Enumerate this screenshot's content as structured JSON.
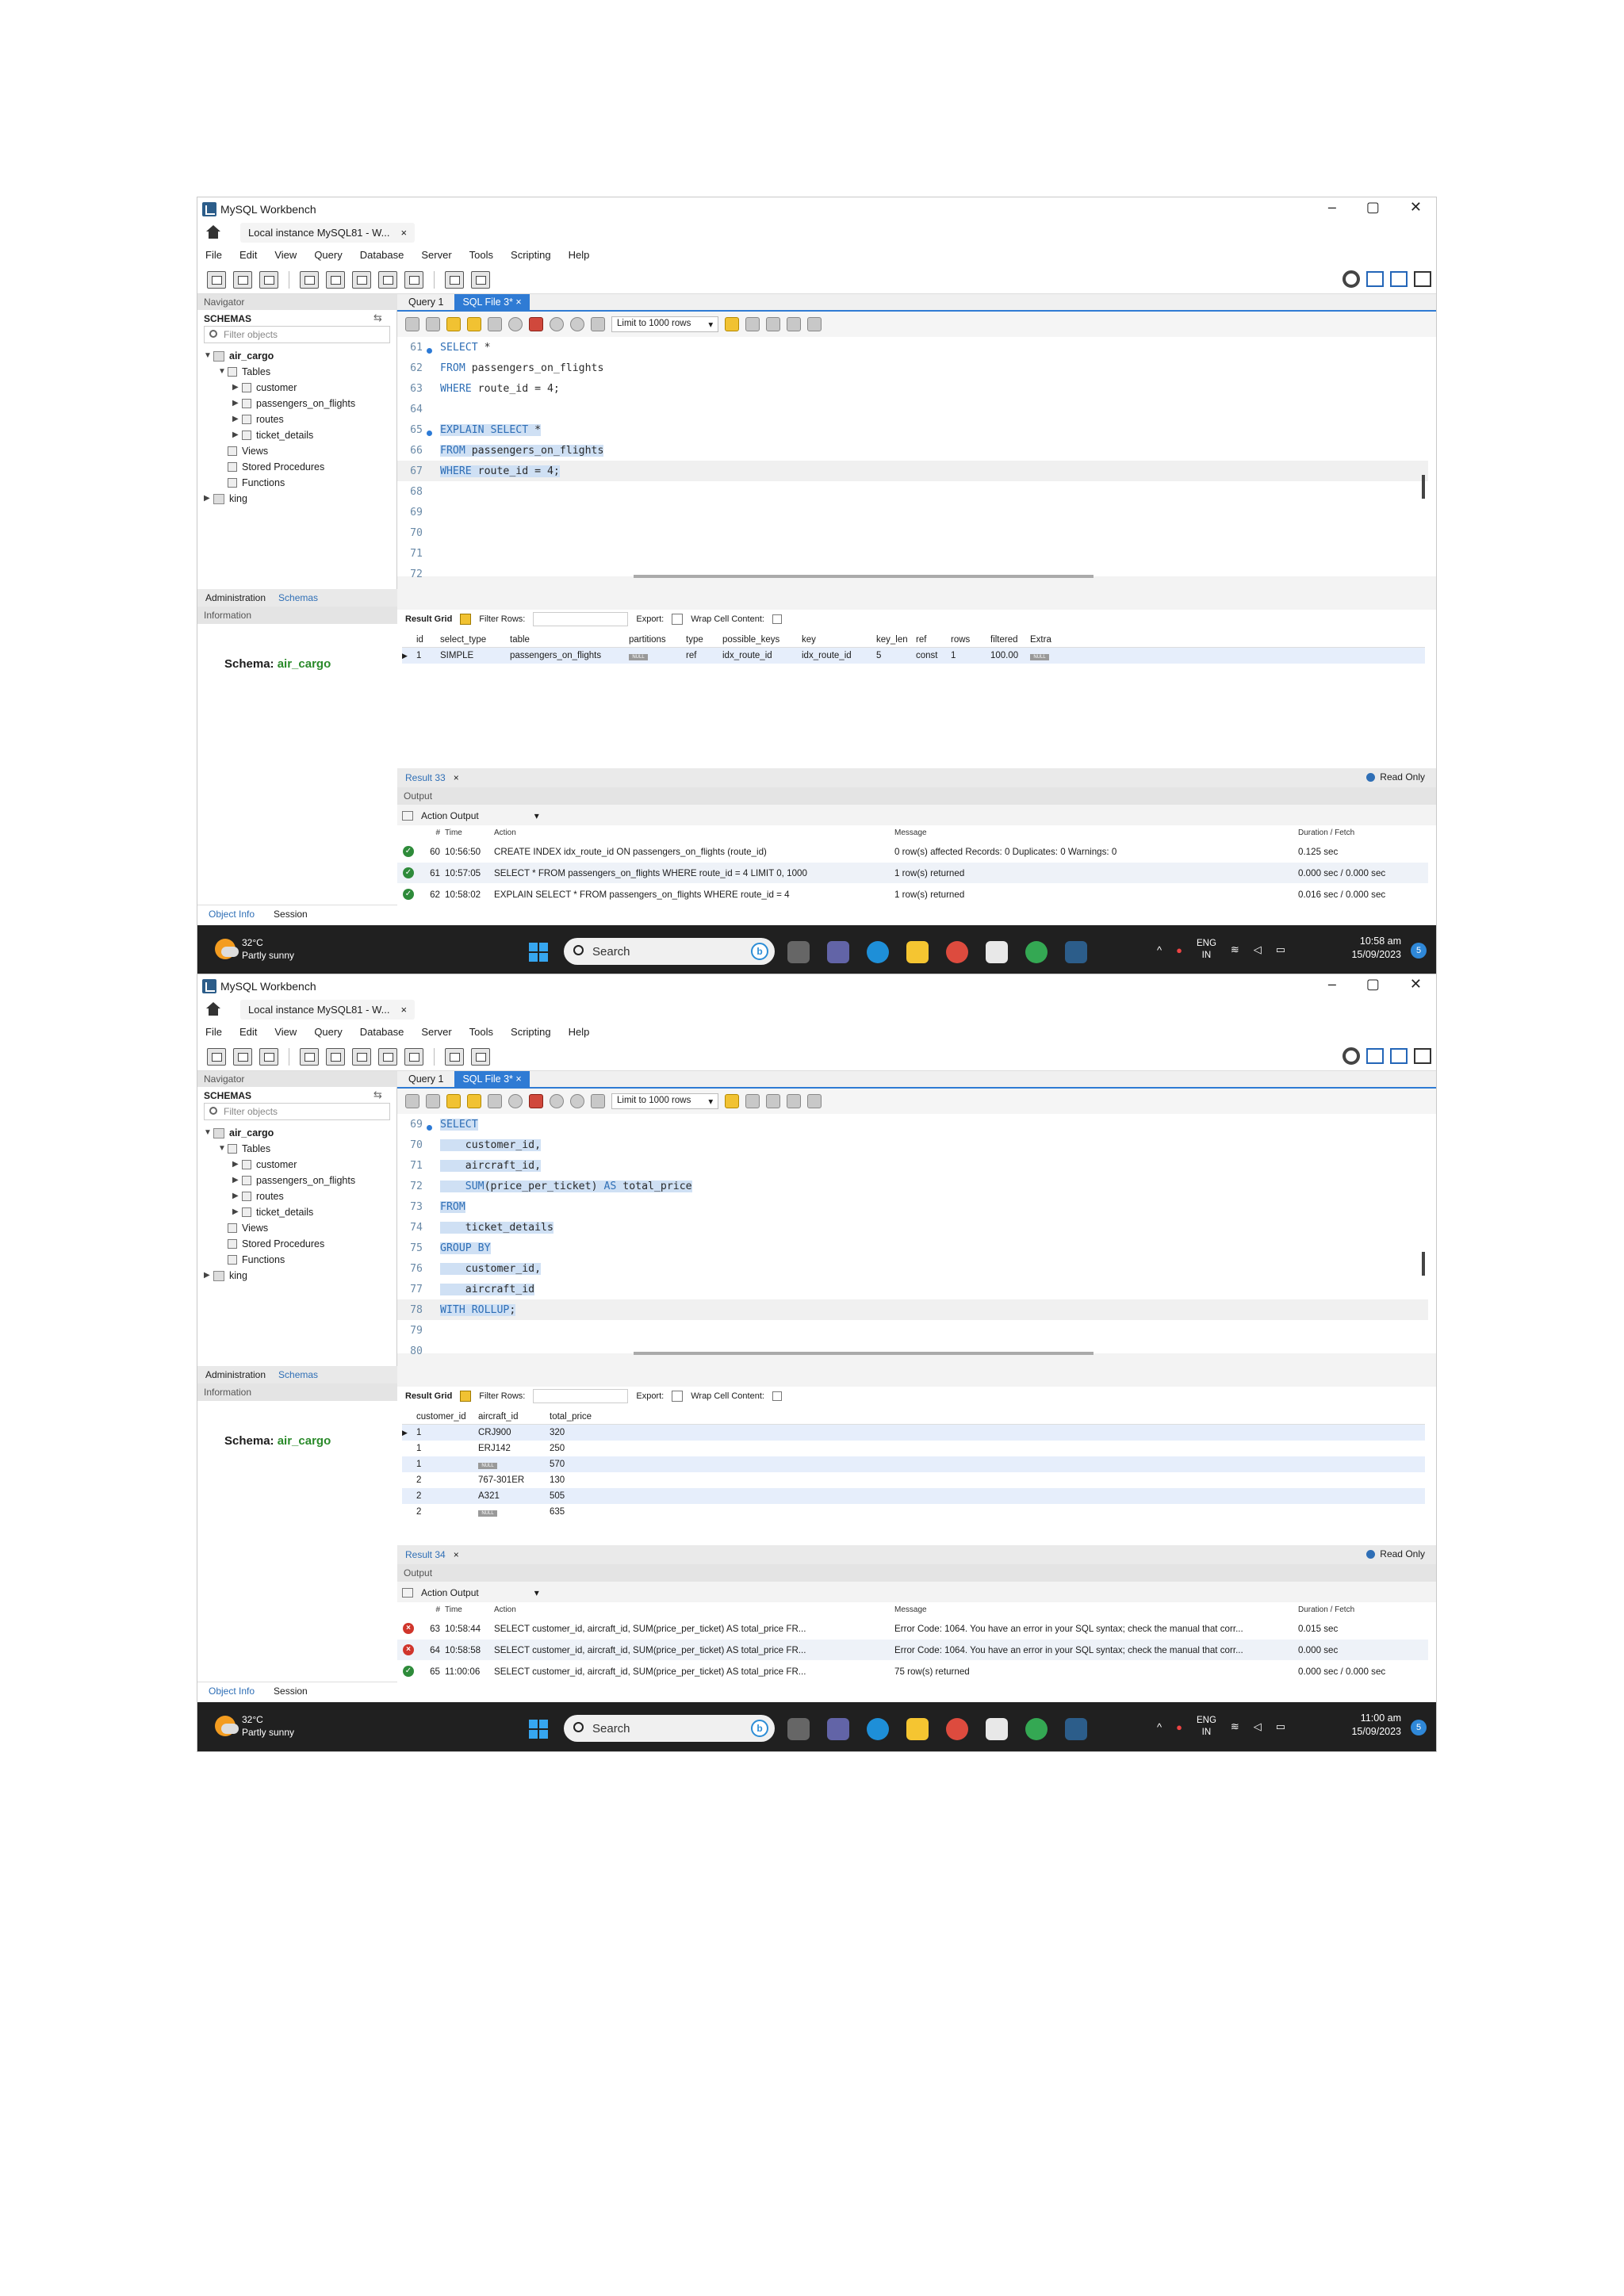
{
  "window": {
    "title": "MySQL Workbench",
    "tab": "Local instance MySQL81 - W...",
    "close_tab": "×",
    "ctl_min": "–",
    "ctl_max": "▢",
    "ctl_close": "✕"
  },
  "menu": [
    "File",
    "Edit",
    "View",
    "Query",
    "Database",
    "Server",
    "Tools",
    "Scripting",
    "Help"
  ],
  "navigator": {
    "header": "Navigator",
    "schemas_title": "SCHEMAS",
    "filter_placeholder": "Filter objects",
    "tree": {
      "db": "air_cargo",
      "tables_label": "Tables",
      "tables": [
        "customer",
        "passengers_on_flights",
        "routes",
        "ticket_details"
      ],
      "views": "Views",
      "procs": "Stored Procedures",
      "funcs": "Functions",
      "other_db": "king"
    },
    "tab_admin": "Administration",
    "tab_schemas": "Schemas",
    "info_header": "Information",
    "schema_label": "Schema:",
    "schema_name": "air_cargo",
    "obj_info": "Object Info",
    "session": "Session"
  },
  "editor_tabs": {
    "query1": "Query 1",
    "sqlfile": "SQL File 3*",
    "close": "×"
  },
  "sql_toolbar": {
    "limit": "Limit to 1000 rows",
    "arrow": "▾"
  },
  "result_toolbar": {
    "grid": "Result Grid",
    "filter": "Filter Rows:",
    "export": "Export:",
    "wrap": "Wrap Cell Content:"
  },
  "output": {
    "header": "Output",
    "selector": "Action Output",
    "col_time": "Time",
    "col_action": "Action",
    "col_message": "Message",
    "col_duration": "Duration / Fetch",
    "col_num": "#"
  },
  "read_only": "Read Only",
  "taskbar": {
    "temp": "32°C",
    "weather": "Partly sunny",
    "search": "Search",
    "lang1": "ENG",
    "lang2": "IN",
    "date": "15/09/2023",
    "notif": "5"
  },
  "shot1": {
    "lines": [
      {
        "n": "61",
        "dot": true,
        "text": "SELECT *",
        "hl": false
      },
      {
        "n": "62",
        "dot": false,
        "text": "FROM passengers_on_flights",
        "hl": false
      },
      {
        "n": "63",
        "dot": false,
        "text": "WHERE route_id = 4;",
        "hl": false
      },
      {
        "n": "64",
        "dot": false,
        "text": "",
        "hl": false
      },
      {
        "n": "65",
        "dot": true,
        "text": "EXPLAIN SELECT *",
        "hl": true
      },
      {
        "n": "66",
        "dot": false,
        "text": "FROM passengers_on_flights",
        "hl": true
      },
      {
        "n": "67",
        "dot": false,
        "text": "WHERE route_id = 4;",
        "hl": true
      },
      {
        "n": "68",
        "dot": false,
        "text": "",
        "hl": false
      },
      {
        "n": "69",
        "dot": false,
        "text": "",
        "hl": false
      },
      {
        "n": "70",
        "dot": false,
        "text": "",
        "hl": false
      },
      {
        "n": "71",
        "dot": false,
        "text": "",
        "hl": false
      },
      {
        "n": "72",
        "dot": false,
        "text": "",
        "hl": false
      }
    ],
    "grid_headers": [
      "id",
      "select_type",
      "table",
      "partitions",
      "type",
      "possible_keys",
      "key",
      "key_len",
      "ref",
      "rows",
      "filtered",
      "Extra"
    ],
    "grid_rows": [
      [
        "1",
        "SIMPLE",
        "passengers_on_flights",
        "NULL",
        "ref",
        "idx_route_id",
        "idx_route_id",
        "5",
        "const",
        "1",
        "100.00",
        "NULL"
      ]
    ],
    "result_tab": "Result 33",
    "outputs": [
      {
        "status": "ok",
        "num": "60",
        "time": "10:56:50",
        "action": "CREATE INDEX idx_route_id ON passengers_on_flights (route_id)",
        "message": "0 row(s) affected Records: 0  Duplicates: 0  Warnings: 0",
        "duration": "0.125 sec"
      },
      {
        "status": "ok",
        "num": "61",
        "time": "10:57:05",
        "action": "SELECT * FROM passengers_on_flights WHERE route_id = 4 LIMIT 0, 1000",
        "message": "1 row(s) returned",
        "duration": "0.000 sec / 0.000 sec"
      },
      {
        "status": "ok",
        "num": "62",
        "time": "10:58:02",
        "action": "EXPLAIN SELECT * FROM passengers_on_flights WHERE route_id = 4",
        "message": "1 row(s) returned",
        "duration": "0.016 sec / 0.000 sec"
      }
    ],
    "clock": "10:58 am"
  },
  "shot2": {
    "lines": [
      {
        "n": "69",
        "dot": true,
        "text": "SELECT",
        "hl": true
      },
      {
        "n": "70",
        "dot": false,
        "text": "    customer_id,",
        "hl": true
      },
      {
        "n": "71",
        "dot": false,
        "text": "    aircraft_id,",
        "hl": true
      },
      {
        "n": "72",
        "dot": false,
        "text": "    SUM(price_per_ticket) AS total_price",
        "hl": true
      },
      {
        "n": "73",
        "dot": false,
        "text": "FROM",
        "hl": true
      },
      {
        "n": "74",
        "dot": false,
        "text": "    ticket_details",
        "hl": true
      },
      {
        "n": "75",
        "dot": false,
        "text": "GROUP BY",
        "hl": true
      },
      {
        "n": "76",
        "dot": false,
        "text": "    customer_id,",
        "hl": true
      },
      {
        "n": "77",
        "dot": false,
        "text": "    aircraft_id",
        "hl": true
      },
      {
        "n": "78",
        "dot": false,
        "text": "WITH ROLLUP;",
        "hl": true
      },
      {
        "n": "79",
        "dot": false,
        "text": "",
        "hl": false
      },
      {
        "n": "80",
        "dot": false,
        "text": "",
        "hl": false
      }
    ],
    "grid_headers": [
      "customer_id",
      "aircraft_id",
      "total_price"
    ],
    "grid_rows": [
      [
        "1",
        "CRJ900",
        "320"
      ],
      [
        "1",
        "ERJ142",
        "250"
      ],
      [
        "1",
        "NULL",
        "570"
      ],
      [
        "2",
        "767-301ER",
        "130"
      ],
      [
        "2",
        "A321",
        "505"
      ],
      [
        "2",
        "NULL",
        "635"
      ]
    ],
    "result_tab": "Result 34",
    "outputs": [
      {
        "status": "err",
        "num": "63",
        "time": "10:58:44",
        "action": "SELECT   customer_id,   aircraft_id,   SUM(price_per_ticket) AS total_price FR...",
        "message": "Error Code: 1064. You have an error in your SQL syntax; check the manual that corr...",
        "duration": "0.015 sec"
      },
      {
        "status": "err",
        "num": "64",
        "time": "10:58:58",
        "action": "SELECT   customer_id,   aircraft_id,   SUM(price_per_ticket) AS total_price FR...",
        "message": "Error Code: 1064. You have an error in your SQL syntax; check the manual that corr...",
        "duration": "0.000 sec"
      },
      {
        "status": "ok",
        "num": "65",
        "time": "11:00:06",
        "action": "SELECT   customer_id,   aircraft_id,   SUM(price_per_ticket) AS total_price FR...",
        "message": "75 row(s) returned",
        "duration": "0.000 sec / 0.000 sec"
      }
    ],
    "clock": "11:00 am"
  },
  "colors": {
    "accent": "#2f7bd4",
    "highlight": "#cfe0f4",
    "ok": "#2e8b3a",
    "error": "#d0352b",
    "taskbar": "#202020"
  }
}
